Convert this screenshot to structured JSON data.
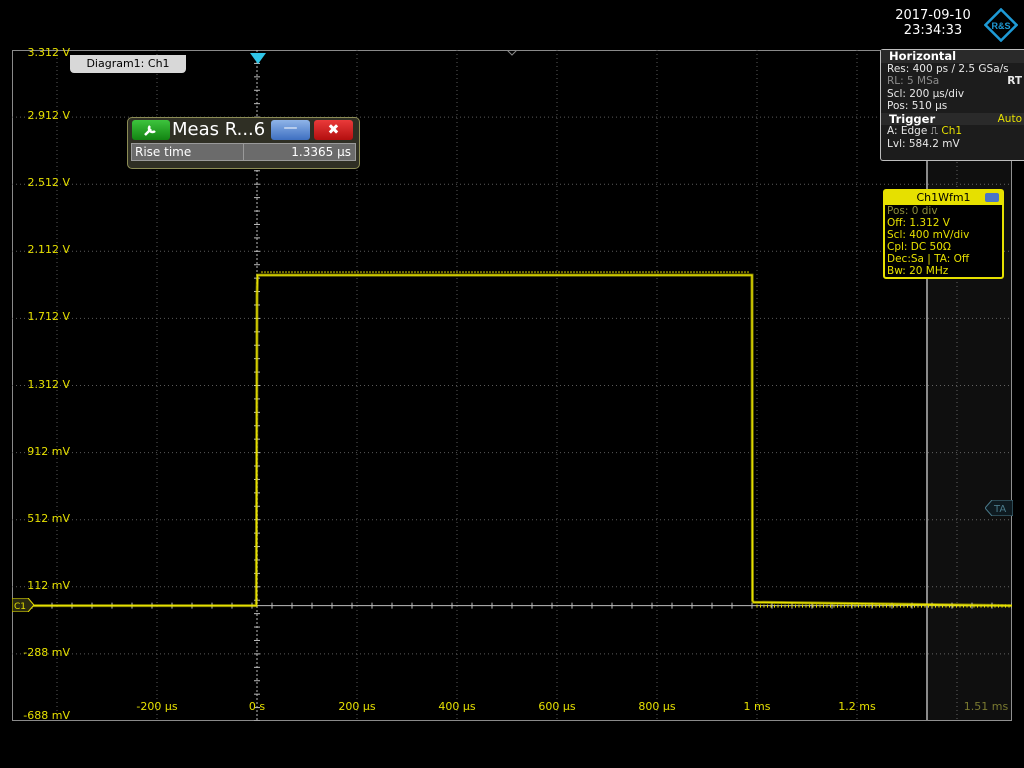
{
  "header": {
    "date": "2017-09-10",
    "time": "23:34:33",
    "logo_text": "R&S"
  },
  "diagram": {
    "tab_label": "Diagram1: Ch1"
  },
  "measurement": {
    "icon": "wrench-icon",
    "title": "Meas R...6",
    "minimize_label": "—",
    "close_label": "✖",
    "row_label": "Rise time",
    "row_value": "1.3365 µs"
  },
  "y_axis_labels": [
    "3.312 V",
    "2.912 V",
    "2.512 V",
    "2.112 V",
    "1.712 V",
    "1.312 V",
    "912 mV",
    "512 mV",
    "112 mV",
    "-288 mV",
    "-688 mV"
  ],
  "x_axis_labels": [
    "-200 µs",
    "0 s",
    "200 µs",
    "400 µs",
    "600 µs",
    "800 µs",
    "1 ms",
    "1.2 ms",
    "1.51 ms"
  ],
  "horizontal_panel": {
    "title": "Horizontal",
    "res": "Res: 400 ps / 2.5 GSa/s",
    "rl": "RL:  5 MSa",
    "rt": "RT",
    "scl": "Scl:  200 µs/div",
    "pos": "Pos:  510 µs",
    "trigger_title": "Trigger",
    "trigger_mode": "Auto",
    "trig_a": "A:   Edge",
    "trig_ch": "Ch1",
    "trig_lvl": "Lvl:  584.2 mV"
  },
  "channel_panel": {
    "title": "Ch1Wfm1",
    "pos": "Pos: 0 div",
    "off": "Off: 1.312 V",
    "scl": "Scl: 400 mV/div",
    "cpl": "Cpl: DC 50Ω",
    "dec": "Dec:Sa | TA: Off",
    "bw": "Bw: 20 MHz"
  },
  "markers": {
    "ch1": "C1",
    "ta": "TA"
  },
  "chart_data": {
    "type": "line",
    "title": "",
    "xlabel": "",
    "ylabel": "",
    "x_unit": "µs",
    "y_unit": "V",
    "xlim": [
      -490,
      1510
    ],
    "ylim": [
      -0.688,
      3.312
    ],
    "grid": true,
    "series": [
      {
        "name": "Ch1",
        "x": [
          -490,
          -1.3,
          0,
          1,
          990,
          991,
          993,
          1510
        ],
        "y": [
          0.0,
          0.0,
          1.85,
          1.97,
          1.97,
          0.03,
          0.02,
          0.0
        ]
      }
    ],
    "colors": {
      "trace": "#e6e000",
      "grid": "#5a5a5a",
      "labels": "#e6e000"
    }
  }
}
